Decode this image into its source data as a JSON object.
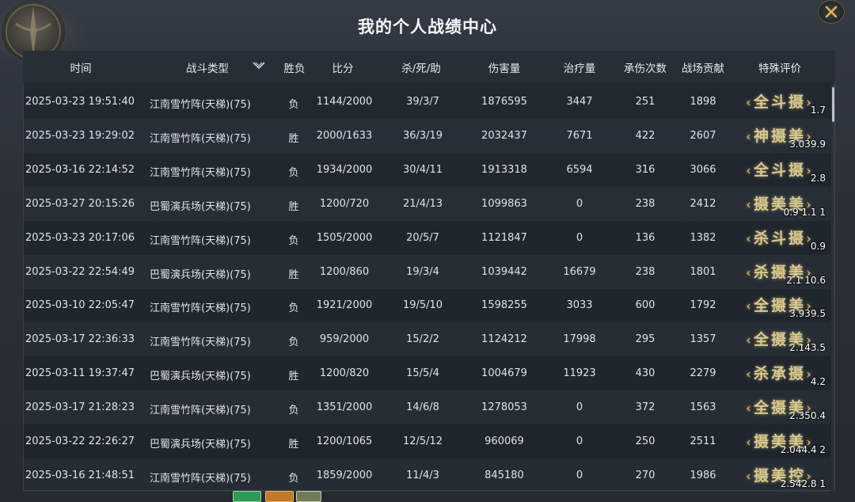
{
  "window": {
    "title": "我的个人战绩中心"
  },
  "columns": {
    "time": "时间",
    "type": "战斗类型",
    "result": "胜负",
    "score": "比分",
    "kda": "杀/死/助",
    "damage": "伤害量",
    "heal": "治疗量",
    "taken": "承伤次数",
    "contribution": "战场贡献",
    "evaluation": "特殊评价"
  },
  "rows": [
    {
      "time": "2025-03-23  19:51:40",
      "type": "江南雪竹阵(天梯)(75)",
      "result": "负",
      "score": "1144/2000",
      "kda": "39/3/7",
      "damage": "1876595",
      "heal": "3447",
      "taken": "251",
      "contribution": "1898",
      "badge": "全斗摄",
      "badge_score": "1.7"
    },
    {
      "time": "2025-03-23  19:29:02",
      "type": "江南雪竹阵(天梯)(75)",
      "result": "胜",
      "score": "2000/1633",
      "kda": "36/3/19",
      "damage": "2032437",
      "heal": "7671",
      "taken": "422",
      "contribution": "2607",
      "badge": "神摄美",
      "badge_score": "3.039.9"
    },
    {
      "time": "2025-03-16  22:14:52",
      "type": "江南雪竹阵(天梯)(75)",
      "result": "负",
      "score": "1934/2000",
      "kda": "30/4/11",
      "damage": "1913318",
      "heal": "6594",
      "taken": "316",
      "contribution": "3066",
      "badge": "全斗摄",
      "badge_score": "2.8"
    },
    {
      "time": "2025-03-27  20:15:26",
      "type": "巴蜀演兵场(天梯)(75)",
      "result": "胜",
      "score": "1200/720",
      "kda": "21/4/13",
      "damage": "1099863",
      "heal": "0",
      "taken": "238",
      "contribution": "2412",
      "badge": "摄美美",
      "badge_score": "0.9  1.1  1"
    },
    {
      "time": "2025-03-23  20:17:06",
      "type": "江南雪竹阵(天梯)(75)",
      "result": "负",
      "score": "1505/2000",
      "kda": "20/5/7",
      "damage": "1121847",
      "heal": "0",
      "taken": "136",
      "contribution": "1382",
      "badge": "杀斗摄",
      "badge_score": "0.9"
    },
    {
      "time": "2025-03-22  22:54:49",
      "type": "巴蜀演兵场(天梯)(75)",
      "result": "胜",
      "score": "1200/860",
      "kda": "19/3/4",
      "damage": "1039442",
      "heal": "16679",
      "taken": "238",
      "contribution": "1801",
      "badge": "杀摄美",
      "badge_score": "2.1 10.6"
    },
    {
      "time": "2025-03-10  22:05:47",
      "type": "江南雪竹阵(天梯)(75)",
      "result": "负",
      "score": "1921/2000",
      "kda": "19/5/10",
      "damage": "1598255",
      "heal": "3033",
      "taken": "600",
      "contribution": "1792",
      "badge": "全摄美",
      "badge_score": "3.939.5"
    },
    {
      "time": "2025-03-17  22:36:33",
      "type": "江南雪竹阵(天梯)(75)",
      "result": "负",
      "score": "959/2000",
      "kda": "15/2/2",
      "damage": "1124212",
      "heal": "17998",
      "taken": "295",
      "contribution": "1357",
      "badge": "全摄美",
      "badge_score": "2.143.5"
    },
    {
      "time": "2025-03-11  19:37:47",
      "type": "巴蜀演兵场(天梯)(75)",
      "result": "胜",
      "score": "1200/820",
      "kda": "15/5/4",
      "damage": "1004679",
      "heal": "11923",
      "taken": "430",
      "contribution": "2279",
      "badge": "杀承摄",
      "badge_score": "4.2"
    },
    {
      "time": "2025-03-17  21:28:23",
      "type": "江南雪竹阵(天梯)(75)",
      "result": "负",
      "score": "1351/2000",
      "kda": "14/6/8",
      "damage": "1278053",
      "heal": "0",
      "taken": "372",
      "contribution": "1563",
      "badge": "全摄美",
      "badge_score": "2.350.4"
    },
    {
      "time": "2025-03-22  22:26:27",
      "type": "巴蜀演兵场(天梯)(75)",
      "result": "胜",
      "score": "1200/1065",
      "kda": "12/5/12",
      "damage": "960069",
      "heal": "0",
      "taken": "250",
      "contribution": "2511",
      "badge": "摄美美",
      "badge_score": "2.044.4  2"
    },
    {
      "time": "2025-03-16  21:48:51",
      "type": "江南雪竹阵(天梯)(75)",
      "result": "负",
      "score": "1859/2000",
      "kda": "11/4/3",
      "damage": "845180",
      "heal": "0",
      "taken": "270",
      "contribution": "1986",
      "badge": "摄美控",
      "badge_score": "2.542.8  1"
    }
  ],
  "colors": {
    "panel_bg": "#1e242c",
    "badge_gold": "#d8c98e",
    "close_accent": "#e0b64a"
  },
  "icons": {
    "close": "close-icon",
    "sort": "chevron-down-icon",
    "emblem": "crest-emblem-icon"
  }
}
